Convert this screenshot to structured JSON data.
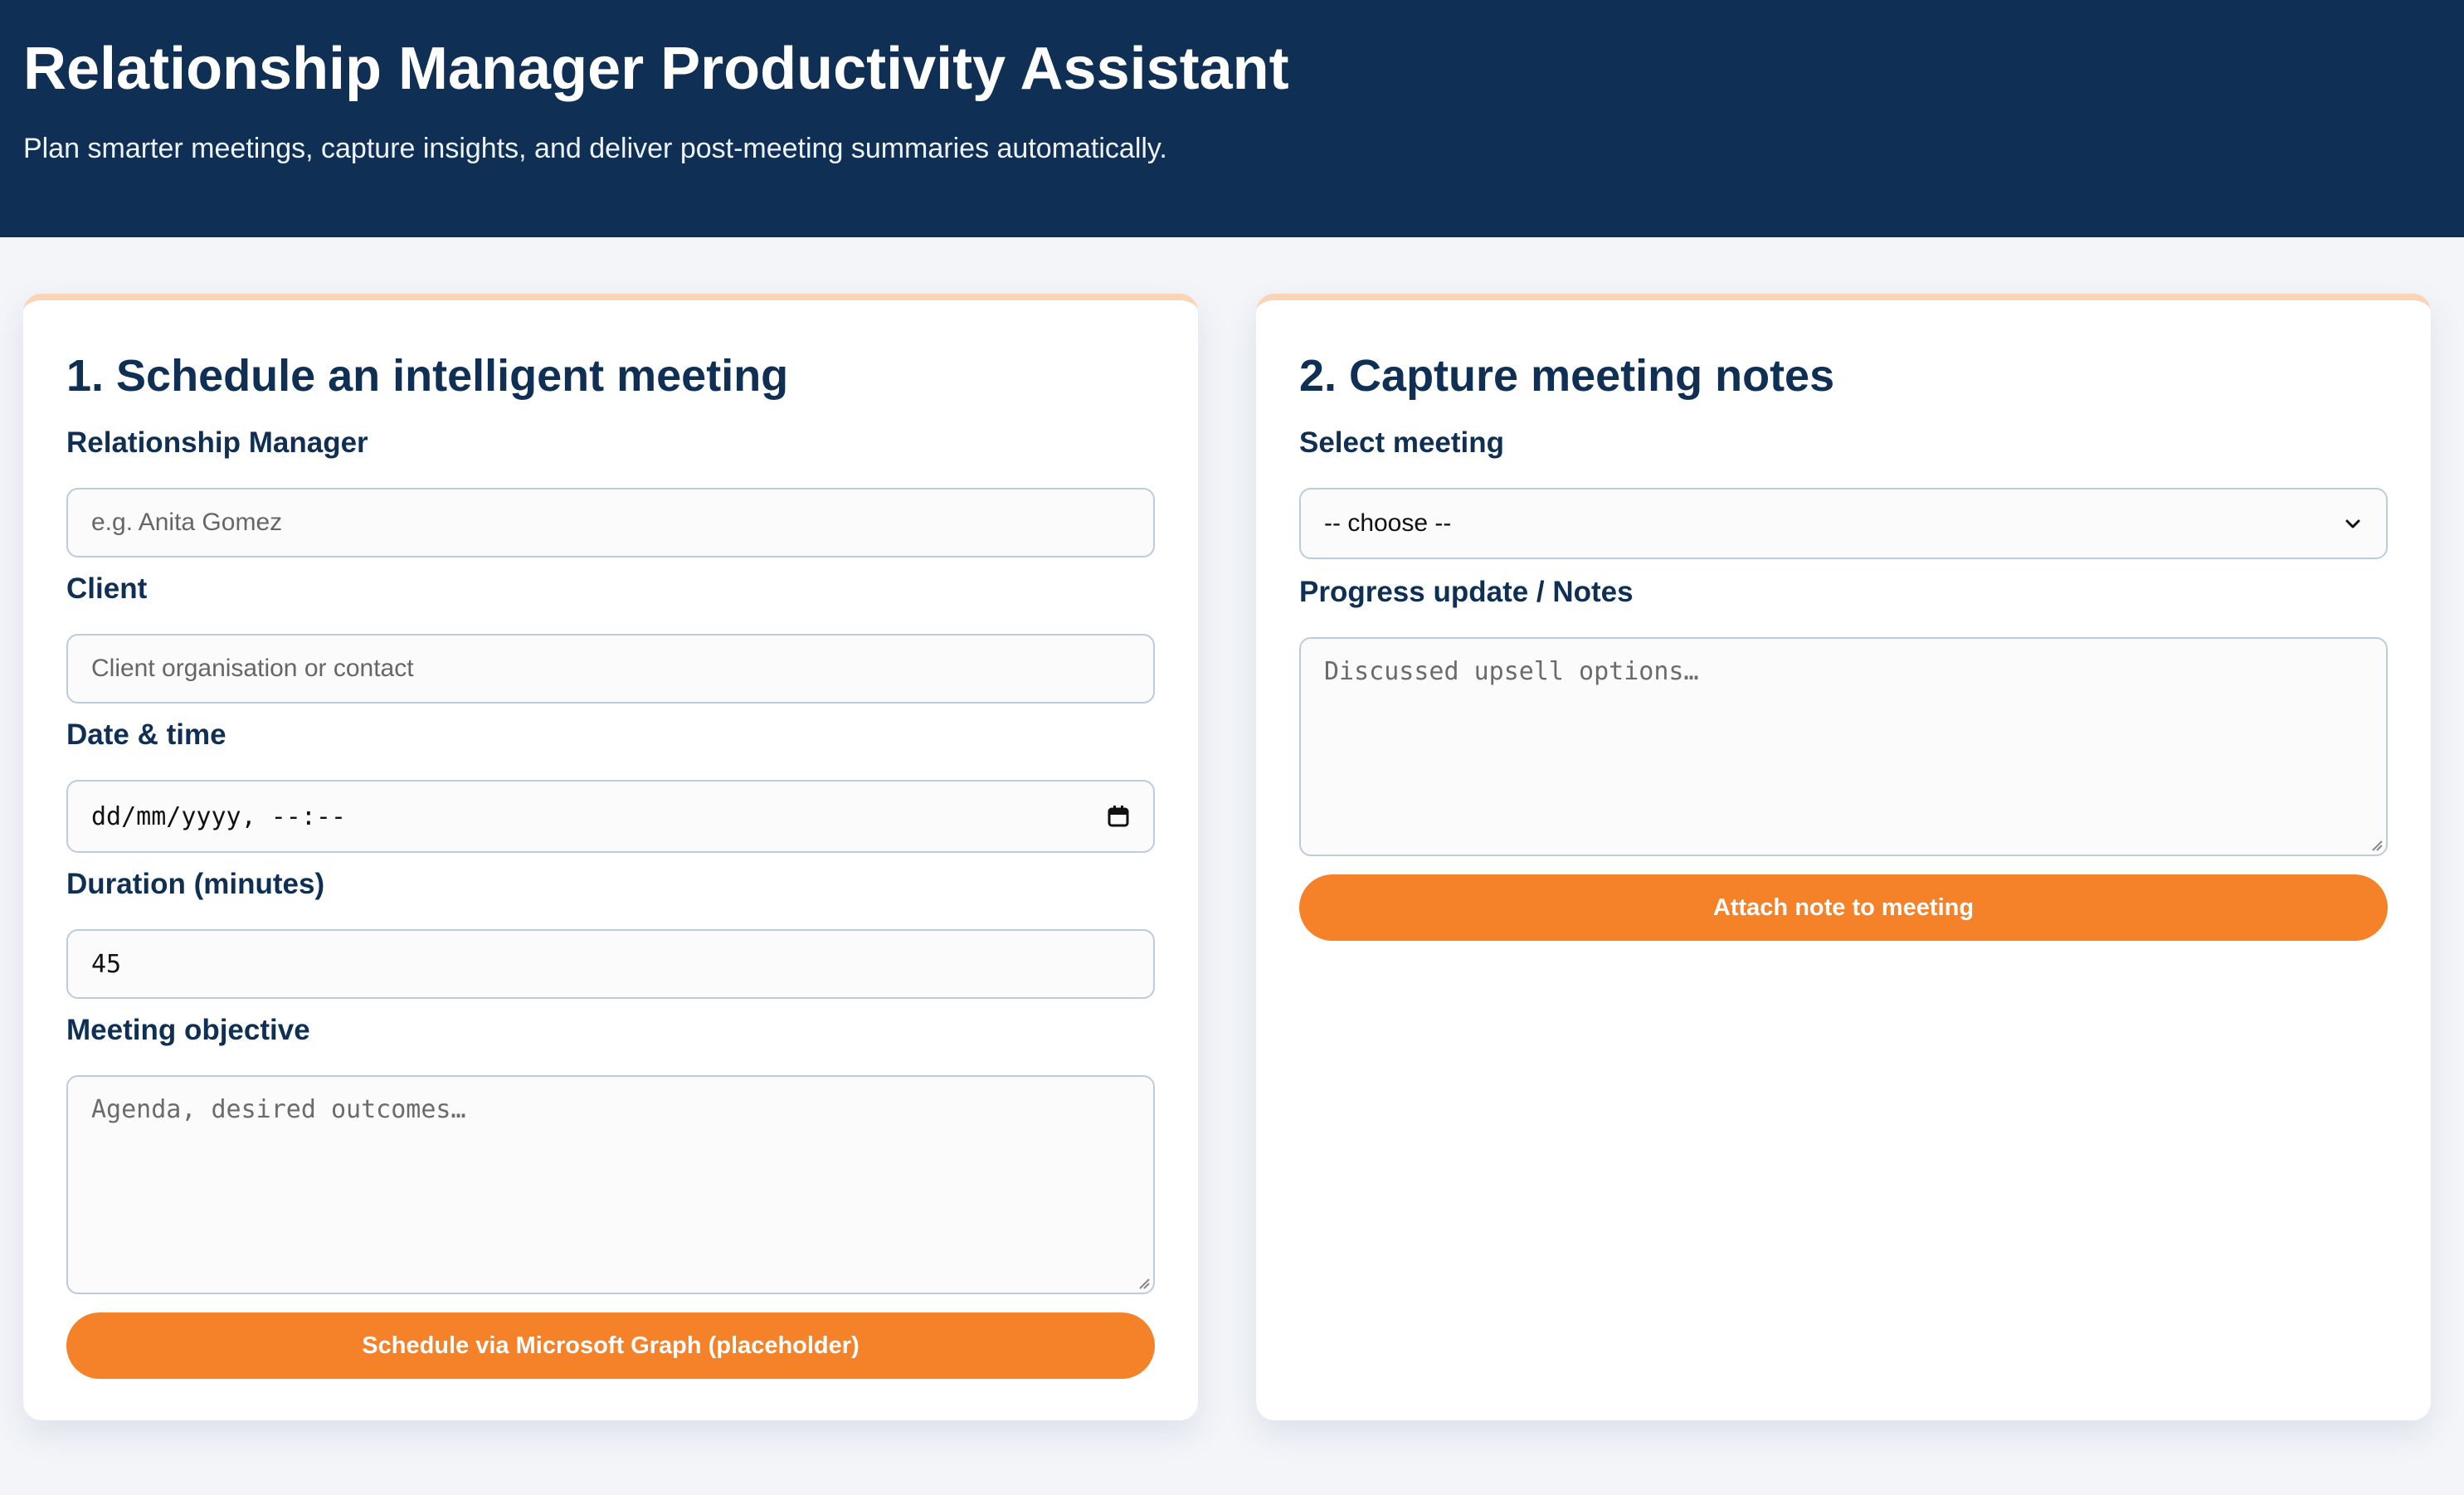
{
  "header": {
    "title": "Relationship Manager Productivity Assistant",
    "subtitle": "Plan smarter meetings, capture insights, and deliver post-meeting summaries automatically."
  },
  "schedule": {
    "heading": "1. Schedule an intelligent meeting",
    "rm_label": "Relationship Manager",
    "rm_placeholder": "e.g. Anita Gomez",
    "client_label": "Client",
    "client_placeholder": "Client organisation or contact",
    "datetime_label": "Date & time",
    "datetime_placeholder": "dd/mm/yyyy, --:--",
    "duration_label": "Duration (minutes)",
    "duration_value": "45",
    "objective_label": "Meeting objective",
    "objective_placeholder": "Agenda, desired outcomes…",
    "button_label": "Schedule via Microsoft Graph (placeholder)"
  },
  "notes": {
    "heading": "2. Capture meeting notes",
    "select_label": "Select meeting",
    "select_value": "-- choose --",
    "notes_label": "Progress update / Notes",
    "notes_placeholder": "Discussed upsell options…",
    "button_label": "Attach note to meeting"
  },
  "colors": {
    "header_bg": "#0f2f55",
    "accent": "#f58228",
    "card_top_border": "#fbd3b5",
    "page_bg": "#f3f5f9"
  },
  "icons": {
    "calendar": "calendar-icon",
    "select_chevron": "chevron-down-icon",
    "resize": "resize-handle-icon"
  }
}
